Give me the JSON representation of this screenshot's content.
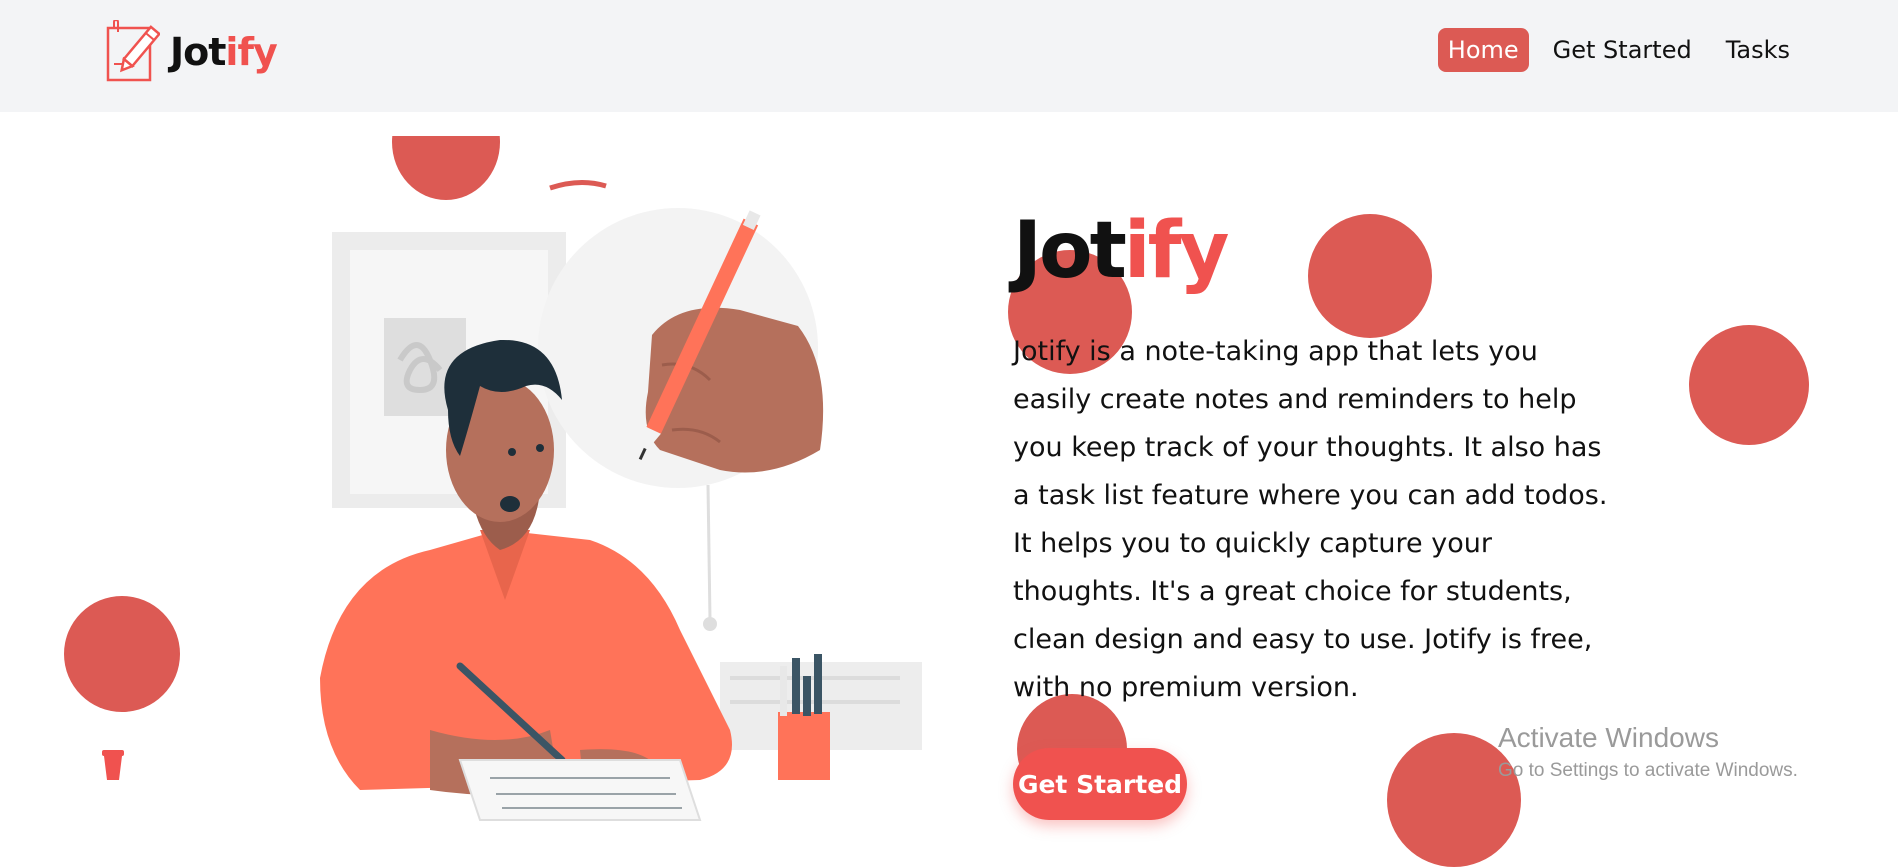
{
  "nav": {
    "brand_part1": "Jot",
    "brand_part2": "ify",
    "links": [
      {
        "label": "Home",
        "active": true
      },
      {
        "label": "Get Started",
        "active": false
      },
      {
        "label": "Tasks",
        "active": false
      }
    ]
  },
  "hero": {
    "title_part1": "Jot",
    "title_part2": "ify",
    "description": "Jotify is a note-taking app that lets you easily create notes and reminders to help you keep track of your thoughts. It also has a task list feature where you can add todos. It helps you to quickly capture your thoughts. It's a great choice for students, clean design and easy to use. Jotify is free, with no premium version.",
    "cta_label": "Get Started"
  },
  "watermark": {
    "title": "Activate Windows",
    "subtitle": "Go to Settings to activate Windows."
  },
  "icons": {
    "logo": "notebook-pencil-icon",
    "cup": "cup-icon"
  },
  "colors": {
    "accent": "#f0524f",
    "circle": "#dc5a54",
    "navbar_bg": "#f3f4f6",
    "shirt": "#ff7359",
    "skin": "#b5705c"
  }
}
